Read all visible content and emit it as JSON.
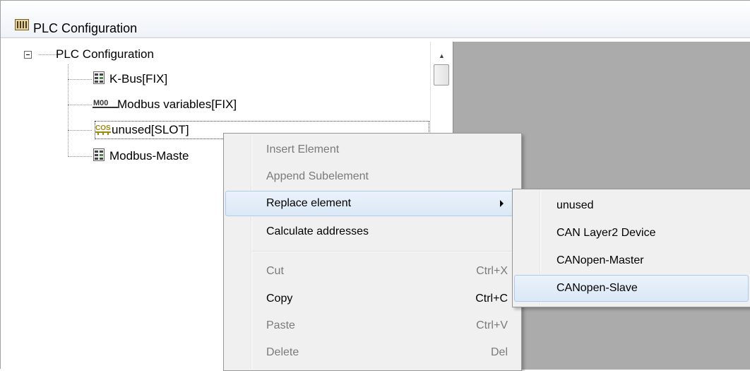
{
  "window": {
    "title": "PLC Configuration",
    "icon": "plc-config-icon"
  },
  "tree": {
    "root": {
      "label": "PLC Configuration"
    },
    "children": [
      {
        "label": "K-Bus[FIX]",
        "icon": "module-icon"
      },
      {
        "label": "Modbus variables[FIX]",
        "icon": "modbus-variables-icon"
      },
      {
        "label": "unused[SLOT]",
        "icon": "cos-slot-icon"
      },
      {
        "label": "Modbus-Maste",
        "icon": "module-icon"
      }
    ],
    "cos_icon_text": "COS",
    "modbus_icon_text": "M00"
  },
  "context_menu": {
    "items": [
      {
        "label": "Insert Element",
        "shortcut": "",
        "disabled": true
      },
      {
        "label": "Append Subelement",
        "shortcut": "",
        "disabled": true
      },
      {
        "label": "Replace element",
        "shortcut": "",
        "disabled": false,
        "submenu": true
      },
      {
        "label": "Calculate addresses",
        "shortcut": "",
        "disabled": false
      },
      {
        "label": "Cut",
        "shortcut": "Ctrl+X",
        "disabled": true
      },
      {
        "label": "Copy",
        "shortcut": "Ctrl+C",
        "disabled": false
      },
      {
        "label": "Paste",
        "shortcut": "Ctrl+V",
        "disabled": true
      },
      {
        "label": "Delete",
        "shortcut": "Del",
        "disabled": true
      }
    ]
  },
  "submenu": {
    "items": [
      {
        "label": "unused"
      },
      {
        "label": "CAN Layer2 Device"
      },
      {
        "label": "CANopen-Master"
      },
      {
        "label": "CANopen-Slave"
      }
    ]
  },
  "colors": {
    "highlight_border": "#aecbeb",
    "highlight_fill": "#dbe8f6",
    "panel_gray": "#ababab",
    "disabled_text": "#7a7a7a"
  }
}
